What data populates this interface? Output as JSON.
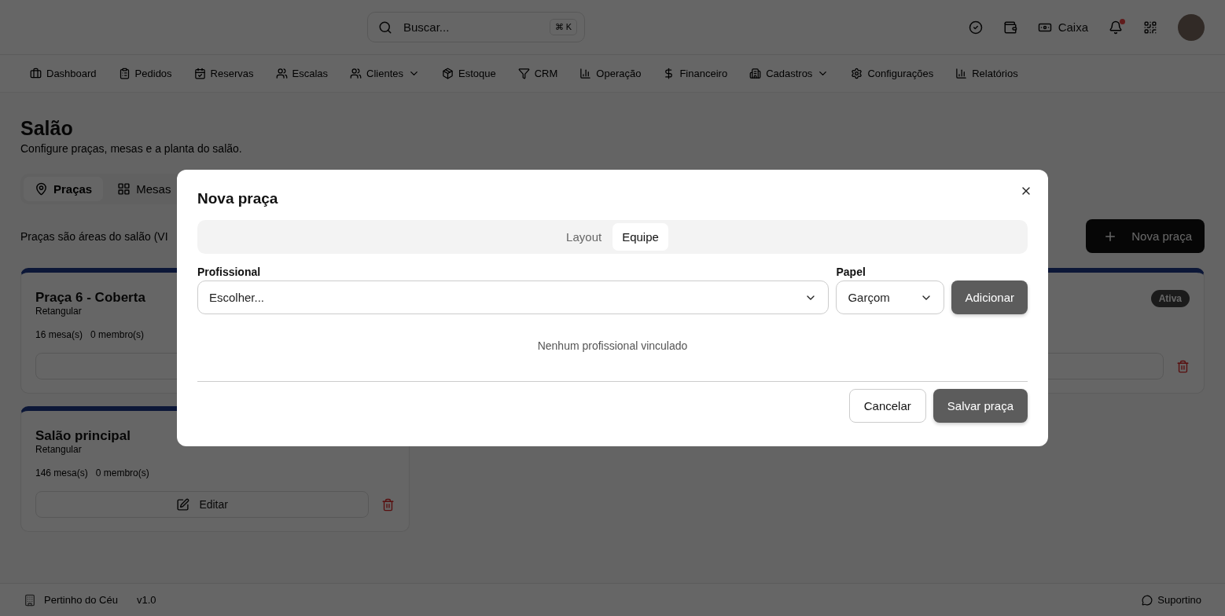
{
  "header": {
    "search": {
      "placeholder": "Buscar...",
      "shortcut": "⌘ K"
    },
    "cash_label": "Caixa",
    "notifications_unread": true
  },
  "nav": [
    {
      "label": "Dashboard",
      "has_menu": false
    },
    {
      "label": "Pedidos",
      "has_menu": false
    },
    {
      "label": "Reservas",
      "has_menu": false
    },
    {
      "label": "Escalas",
      "has_menu": false
    },
    {
      "label": "Clientes",
      "has_menu": true
    },
    {
      "label": "Estoque",
      "has_menu": false
    },
    {
      "label": "CRM",
      "has_menu": false
    },
    {
      "label": "Operação",
      "has_menu": false
    },
    {
      "label": "Financeiro",
      "has_menu": false
    },
    {
      "label": "Cadastros",
      "has_menu": true
    },
    {
      "label": "Configurações",
      "has_menu": false
    },
    {
      "label": "Relatórios",
      "has_menu": false
    }
  ],
  "page": {
    "title": "Salão",
    "subtitle": "Configure praças, mesas e a planta do salão.",
    "tabs": [
      {
        "label": "Praças",
        "selected": true
      },
      {
        "label": "Mesas",
        "selected": false
      }
    ],
    "description": "Praças são áreas do salão (VI",
    "new_button": "Nova praça",
    "cards": [
      {
        "title": "Praça 6 - Coberta",
        "shape": "Retangular",
        "tables": "16 mesa(s)",
        "members": "0 membro(s)"
      },
      {
        "badge": "Ativa"
      },
      {
        "title": "Salão principal",
        "shape": "Retangular",
        "tables": "146 mesa(s)",
        "members": "0 membro(s)",
        "edit_label": "Editar"
      }
    ]
  },
  "footer": {
    "company": "Pertinho do Céu",
    "version": "v1.0",
    "support": "Suportino"
  },
  "dialog": {
    "title": "Nova praça",
    "tabs": [
      {
        "label": "Layout",
        "selected": false
      },
      {
        "label": "Equipe",
        "selected": true
      }
    ],
    "professional": {
      "label": "Profissional",
      "placeholder": "Escolher..."
    },
    "role": {
      "label": "Papel",
      "value": "Garçom"
    },
    "add_button": "Adicionar",
    "empty_text": "Nenhum profissional vinculado",
    "buttons": [
      {
        "label": "Cancelar",
        "kind": "secondary"
      },
      {
        "label": "Salvar praça",
        "kind": "primary"
      }
    ]
  }
}
